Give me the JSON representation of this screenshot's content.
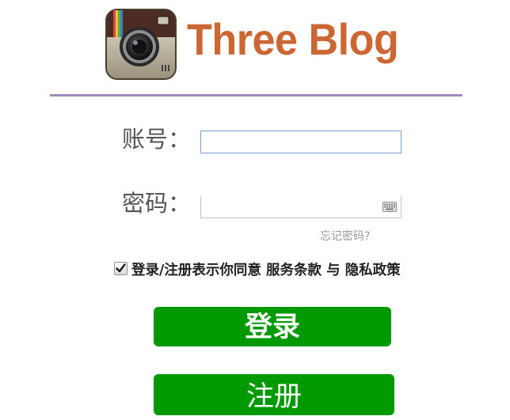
{
  "brand": {
    "title": "Three Blog",
    "accent_color": "#cc6633",
    "logo_icon": "camera-icon"
  },
  "divider_color": "#a08cbc",
  "form": {
    "account_label": "账号：",
    "account_value": "",
    "password_label": "密码：",
    "password_value": "",
    "keyboard_icon": "keyboard-icon",
    "forgot_password": "忘记密码?"
  },
  "agreement": {
    "checked": true,
    "prefix": "登录/注册表示你同意",
    "terms": "服务条款",
    "connector": "与",
    "privacy": "隐私政策"
  },
  "buttons": {
    "login_label": "登录",
    "register_label": "注册",
    "color": "#009900"
  }
}
